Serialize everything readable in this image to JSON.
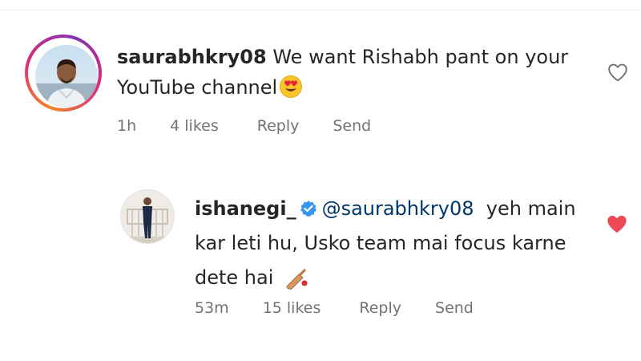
{
  "comments": [
    {
      "username": "saurabhkry08",
      "text": "We want Rishabh pant on your YouTube channel",
      "emoji_icon": "heart-eyes-emoji-icon",
      "time": "1h",
      "likes": "4 likes",
      "reply_label": "Reply",
      "send_label": "Send",
      "liked": false,
      "avatar_ring": true
    },
    {
      "username": "ishanegi_",
      "verified": true,
      "mention": "@saurabhkry08",
      "text": "yeh main kar leti hu, Usko team mai focus karne dete hai",
      "emoji_icon": "cricket-bat-emoji-icon",
      "time": "53m",
      "likes": "15 likes",
      "reply_label": "Reply",
      "send_label": "Send",
      "liked": true
    }
  ],
  "colors": {
    "text": "#262626",
    "secondary": "#737373",
    "mention": "#00376b",
    "verified": "#3897f0",
    "liked_heart": "#ed4956",
    "ring_start": "#f58529",
    "ring_end": "#dd2a7b"
  }
}
